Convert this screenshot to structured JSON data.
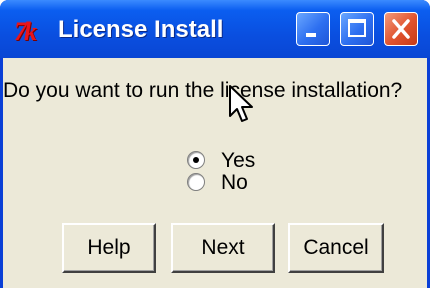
{
  "window": {
    "title": "License Install",
    "app_icon_text": "7k"
  },
  "dialog": {
    "question": "Do you want to run the license installation?",
    "options": [
      {
        "label": "Yes",
        "selected": true
      },
      {
        "label": "No",
        "selected": false
      }
    ]
  },
  "buttons": {
    "help": "Help",
    "next": "Next",
    "cancel": "Cancel"
  },
  "colors": {
    "titlebar": "#0a4fe0",
    "dialog_bg": "#ece9d8",
    "close_button": "#e0522d",
    "app_icon": "#e8141c"
  },
  "icons": [
    "tk-icon",
    "minimize-icon",
    "maximize-icon",
    "close-icon",
    "mouse-cursor-icon"
  ]
}
